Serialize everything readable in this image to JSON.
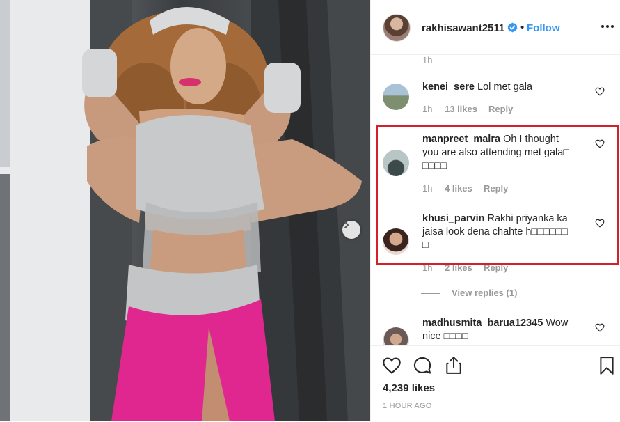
{
  "header": {
    "username": "rakhisawant2511",
    "separator": "•",
    "follow_label": "Follow"
  },
  "comments": {
    "top_time": "1h",
    "items": [
      {
        "username": "kenei_sere",
        "text": "Lol met gala",
        "time": "1h",
        "likes": "13 likes",
        "reply": "Reply"
      },
      {
        "username": "manpreet_malra",
        "text_line1": "Oh I thought",
        "text_line2": "you are also attending met gala□",
        "text_line3": "□□□□",
        "time": "1h",
        "likes": "4 likes",
        "reply": "Reply"
      },
      {
        "username": "khusi_parvin",
        "text_line1": "Rakhi priyanka ka",
        "text_line2": "jaisa look dena chahte h□□□□□□",
        "text_line3": "□",
        "time": "1h",
        "likes": "2 likes",
        "reply": "Reply"
      },
      {
        "username": "madhusmita_barua12345",
        "text_line1": "Wow",
        "text_line2": "nice □□□□"
      }
    ],
    "view_replies": "View replies (1)"
  },
  "footer": {
    "likes": "4,239 likes",
    "time": "1 HOUR AGO"
  },
  "colors": {
    "accent": "#3897f0",
    "highlight": "#d3202a",
    "costume_pink": "#e0278f"
  },
  "icons": [
    "verified-icon",
    "more-icon",
    "heart-icon",
    "comment-icon",
    "share-icon",
    "bookmark-icon",
    "chevron-right-icon"
  ]
}
